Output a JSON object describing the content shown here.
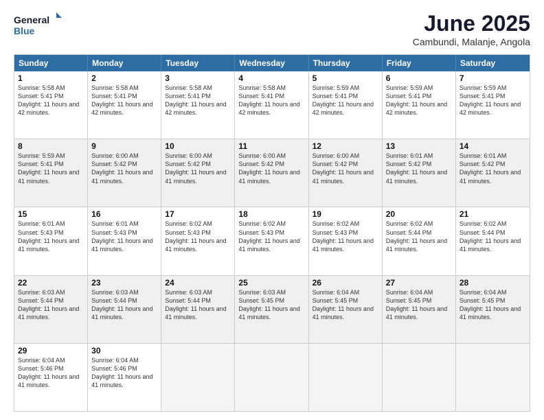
{
  "logo": {
    "line1": "General",
    "line2": "Blue"
  },
  "title": "June 2025",
  "subtitle": "Cambundi, Malanje, Angola",
  "days": [
    "Sunday",
    "Monday",
    "Tuesday",
    "Wednesday",
    "Thursday",
    "Friday",
    "Saturday"
  ],
  "weeks": [
    [
      {
        "day": 1,
        "sunrise": "5:58 AM",
        "sunset": "5:41 PM",
        "daylight": "11 hours and 42 minutes.",
        "shaded": false
      },
      {
        "day": 2,
        "sunrise": "5:58 AM",
        "sunset": "5:41 PM",
        "daylight": "11 hours and 42 minutes.",
        "shaded": false
      },
      {
        "day": 3,
        "sunrise": "5:58 AM",
        "sunset": "5:41 PM",
        "daylight": "11 hours and 42 minutes.",
        "shaded": false
      },
      {
        "day": 4,
        "sunrise": "5:58 AM",
        "sunset": "5:41 PM",
        "daylight": "11 hours and 42 minutes.",
        "shaded": false
      },
      {
        "day": 5,
        "sunrise": "5:59 AM",
        "sunset": "5:41 PM",
        "daylight": "11 hours and 42 minutes.",
        "shaded": false
      },
      {
        "day": 6,
        "sunrise": "5:59 AM",
        "sunset": "5:41 PM",
        "daylight": "11 hours and 42 minutes.",
        "shaded": false
      },
      {
        "day": 7,
        "sunrise": "5:59 AM",
        "sunset": "5:41 PM",
        "daylight": "11 hours and 42 minutes.",
        "shaded": false
      }
    ],
    [
      {
        "day": 8,
        "sunrise": "5:59 AM",
        "sunset": "5:41 PM",
        "daylight": "11 hours and 41 minutes.",
        "shaded": true
      },
      {
        "day": 9,
        "sunrise": "6:00 AM",
        "sunset": "5:42 PM",
        "daylight": "11 hours and 41 minutes.",
        "shaded": true
      },
      {
        "day": 10,
        "sunrise": "6:00 AM",
        "sunset": "5:42 PM",
        "daylight": "11 hours and 41 minutes.",
        "shaded": true
      },
      {
        "day": 11,
        "sunrise": "6:00 AM",
        "sunset": "5:42 PM",
        "daylight": "11 hours and 41 minutes.",
        "shaded": true
      },
      {
        "day": 12,
        "sunrise": "6:00 AM",
        "sunset": "5:42 PM",
        "daylight": "11 hours and 41 minutes.",
        "shaded": true
      },
      {
        "day": 13,
        "sunrise": "6:01 AM",
        "sunset": "5:42 PM",
        "daylight": "11 hours and 41 minutes.",
        "shaded": true
      },
      {
        "day": 14,
        "sunrise": "6:01 AM",
        "sunset": "5:42 PM",
        "daylight": "11 hours and 41 minutes.",
        "shaded": true
      }
    ],
    [
      {
        "day": 15,
        "sunrise": "6:01 AM",
        "sunset": "5:43 PM",
        "daylight": "11 hours and 41 minutes.",
        "shaded": false
      },
      {
        "day": 16,
        "sunrise": "6:01 AM",
        "sunset": "5:43 PM",
        "daylight": "11 hours and 41 minutes.",
        "shaded": false
      },
      {
        "day": 17,
        "sunrise": "6:02 AM",
        "sunset": "5:43 PM",
        "daylight": "11 hours and 41 minutes.",
        "shaded": false
      },
      {
        "day": 18,
        "sunrise": "6:02 AM",
        "sunset": "5:43 PM",
        "daylight": "11 hours and 41 minutes.",
        "shaded": false
      },
      {
        "day": 19,
        "sunrise": "6:02 AM",
        "sunset": "5:43 PM",
        "daylight": "11 hours and 41 minutes.",
        "shaded": false
      },
      {
        "day": 20,
        "sunrise": "6:02 AM",
        "sunset": "5:44 PM",
        "daylight": "11 hours and 41 minutes.",
        "shaded": false
      },
      {
        "day": 21,
        "sunrise": "6:02 AM",
        "sunset": "5:44 PM",
        "daylight": "11 hours and 41 minutes.",
        "shaded": false
      }
    ],
    [
      {
        "day": 22,
        "sunrise": "6:03 AM",
        "sunset": "5:44 PM",
        "daylight": "11 hours and 41 minutes.",
        "shaded": true
      },
      {
        "day": 23,
        "sunrise": "6:03 AM",
        "sunset": "5:44 PM",
        "daylight": "11 hours and 41 minutes.",
        "shaded": true
      },
      {
        "day": 24,
        "sunrise": "6:03 AM",
        "sunset": "5:44 PM",
        "daylight": "11 hours and 41 minutes.",
        "shaded": true
      },
      {
        "day": 25,
        "sunrise": "6:03 AM",
        "sunset": "5:45 PM",
        "daylight": "11 hours and 41 minutes.",
        "shaded": true
      },
      {
        "day": 26,
        "sunrise": "6:04 AM",
        "sunset": "5:45 PM",
        "daylight": "11 hours and 41 minutes.",
        "shaded": true
      },
      {
        "day": 27,
        "sunrise": "6:04 AM",
        "sunset": "5:45 PM",
        "daylight": "11 hours and 41 minutes.",
        "shaded": true
      },
      {
        "day": 28,
        "sunrise": "6:04 AM",
        "sunset": "5:45 PM",
        "daylight": "11 hours and 41 minutes.",
        "shaded": true
      }
    ],
    [
      {
        "day": 29,
        "sunrise": "6:04 AM",
        "sunset": "5:46 PM",
        "daylight": "11 hours and 41 minutes.",
        "shaded": false
      },
      {
        "day": 30,
        "sunrise": "6:04 AM",
        "sunset": "5:46 PM",
        "daylight": "11 hours and 41 minutes.",
        "shaded": false
      },
      null,
      null,
      null,
      null,
      null
    ]
  ]
}
